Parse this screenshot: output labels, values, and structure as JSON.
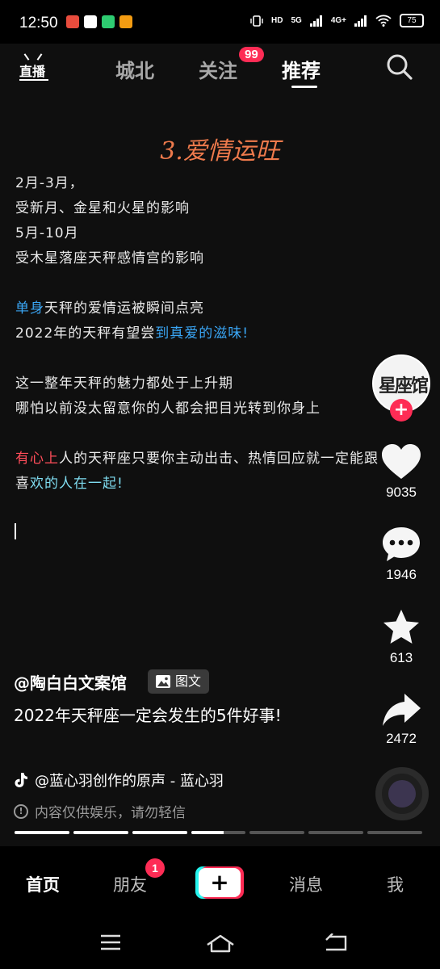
{
  "status_bar": {
    "time": "12:50",
    "hd": "HD",
    "net1": "5G",
    "net2": "4G+",
    "battery": "75",
    "app_icon_colors": [
      "#e84c3d",
      "#ffffff",
      "#2ecc71",
      "#f39c12"
    ]
  },
  "top_nav": {
    "live_icon": "live-tv-icon",
    "live_label": "直播",
    "tabs": [
      {
        "label": "城北",
        "active": false
      },
      {
        "label": "关注",
        "active": false,
        "badge": "99"
      },
      {
        "label": "推荐",
        "active": true
      }
    ],
    "search_icon": "search-icon"
  },
  "post": {
    "headline": "3.爱情运旺",
    "lines": {
      "l1": "2月-3月，",
      "l2": "受新月、金星和火星的影响",
      "l3": "5月-10月",
      "l4": "受木星落座天秤感情宫的影响",
      "l5a": "单身",
      "l5b": "天秤的爱情运被瞬间点亮",
      "l6a": "2022年的天秤有望尝",
      "l6b": "到真爱的滋味!",
      "l7": "这一整年天秤的魅力都处于上升期",
      "l8": "哪怕以前没太留意你的人都会把目光转到你身上",
      "l9a": "有心上",
      "l9b": "人的天秤座只要你主动出击、热情回应就一定能跟",
      "l10a": "喜",
      "l10b": "欢的人在一起!"
    },
    "author": "@陶白白文案馆",
    "type_tag": "图文",
    "caption": "2022年天秤座一定会发生的5件好事!",
    "music": "@蓝心羽创作的原声 - 蓝心羽",
    "disclaimer": "内容仅供娱乐，请勿轻信",
    "progress_segments": [
      1,
      1,
      1,
      0.6,
      0,
      0,
      0
    ]
  },
  "rail": {
    "avatar_text": "星座馆",
    "likes": "9035",
    "comments": "1946",
    "favorites": "613",
    "shares": "2472"
  },
  "bottom_nav": {
    "home": "首页",
    "friends": "朋友",
    "friends_badge": "1",
    "create": "+",
    "messages": "消息",
    "me": "我"
  },
  "colors": {
    "accent_red": "#fe2c55",
    "accent_cyan": "#25f4ee",
    "headline": "#ee7a4c",
    "highlight_blue": "#3aa6f5",
    "highlight_red": "#ff4d5a"
  }
}
